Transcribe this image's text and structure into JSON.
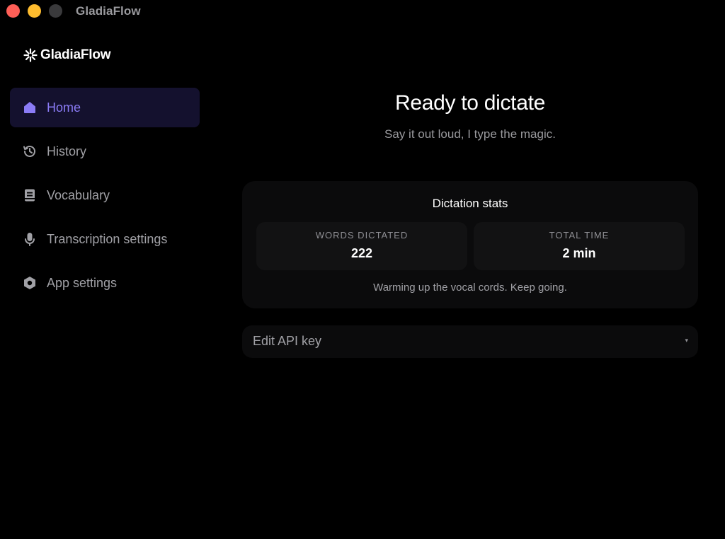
{
  "window": {
    "title": "GladiaFlow"
  },
  "sidebar": {
    "brand": "GladiaFlow",
    "items": [
      {
        "label": "Home",
        "icon": "home-icon",
        "active": true
      },
      {
        "label": "History",
        "icon": "history-icon",
        "active": false
      },
      {
        "label": "Vocabulary",
        "icon": "book-icon",
        "active": false
      },
      {
        "label": "Transcription settings",
        "icon": "microphone-icon",
        "active": false
      },
      {
        "label": "App settings",
        "icon": "settings-icon",
        "active": false
      }
    ]
  },
  "main": {
    "headline": "Ready to dictate",
    "subhead": "Say it out loud, I type the magic.",
    "stats": {
      "title": "Dictation stats",
      "words_label": "WORDS DICTATED",
      "words_value": "222",
      "time_label": "TOTAL TIME",
      "time_value": "2 min",
      "footer": "Warming up the vocal cords. Keep going."
    },
    "api_key": {
      "label": "Edit API key",
      "caret": "▾"
    }
  },
  "colors": {
    "accent": "#8b7cf6",
    "active_bg": "#14112e",
    "background": "#000000",
    "card": "#0b0b0c",
    "traffic_close": "#ff5f57",
    "traffic_minimize": "#febc2e",
    "traffic_maximize": "#3a3a3c"
  }
}
